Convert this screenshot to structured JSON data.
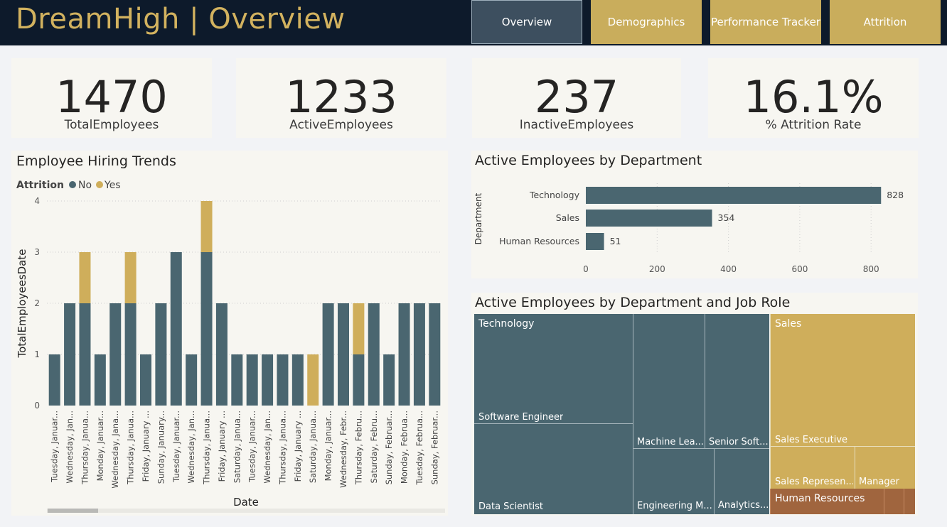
{
  "header": {
    "title": "DreamHigh | Overview"
  },
  "nav": [
    {
      "label": "Overview",
      "active": true
    },
    {
      "label": "Demographics",
      "active": false
    },
    {
      "label": "Performance Tracker",
      "active": false
    },
    {
      "label": "Attrition",
      "active": false
    }
  ],
  "kpis": [
    {
      "value": "1470",
      "label": "TotalEmployees"
    },
    {
      "value": "1233",
      "label": "ActiveEmployees"
    },
    {
      "value": "237",
      "label": "InactiveEmployees"
    },
    {
      "value": "16.1%",
      "label": "% Attrition Rate"
    }
  ],
  "colors": {
    "no": "#4a6670",
    "yes": "#cfae5b",
    "hr": "#a0653e",
    "bg": "#f7f6f1"
  },
  "chart_data": [
    {
      "type": "bar",
      "stacked": true,
      "title": "Employee Hiring Trends",
      "legend_title": "Attrition",
      "xlabel": "Date",
      "ylabel": "TotalEmployeesDate",
      "ylim": [
        0,
        4
      ],
      "yticks": [
        0,
        1,
        2,
        3,
        4
      ],
      "categories": [
        "Tuesday, Januar...",
        "Wednesday, Jan...",
        "Thursday, Janua...",
        "Monday, Januar...",
        "Wednesday, Jana...",
        "Thursday, Janua...",
        "Friday, January ...",
        "Sunday, January...",
        "Tuesday, Januar...",
        "Wednesday, Jan...",
        "Thursday, Janua...",
        "Friday, January ...",
        "Saturday, Janua...",
        "Tuesday, Januar...",
        "Wednesday, Jan...",
        "Thursday, Janua...",
        "Friday, January ...",
        "Saturday, Janua...",
        "Monday, Januar...",
        "Wednesday, Febr...",
        "Thursday, Febru...",
        "Saturday, Febru...",
        "Sunday, Februar...",
        "Monday, Februa...",
        "Tuesday, Februa...",
        "Sunday, Februar..."
      ],
      "series": [
        {
          "name": "No",
          "values": [
            1,
            2,
            2,
            1,
            2,
            2,
            1,
            2,
            3,
            1,
            3,
            2,
            1,
            1,
            1,
            1,
            1,
            0,
            2,
            2,
            1,
            2,
            1,
            2,
            2,
            2
          ]
        },
        {
          "name": "Yes",
          "values": [
            0,
            0,
            1,
            0,
            0,
            1,
            0,
            0,
            0,
            0,
            1,
            0,
            0,
            0,
            0,
            0,
            0,
            1,
            0,
            0,
            1,
            0,
            0,
            0,
            0,
            0
          ]
        }
      ],
      "legend_placement": "top-left",
      "grid": true
    },
    {
      "type": "bar",
      "orientation": "horizontal",
      "title": "Active Employees by Department",
      "ylabel": "Department",
      "xlabel": "",
      "categories": [
        "Technology",
        "Sales",
        "Human Resources"
      ],
      "values": [
        828,
        354,
        51
      ],
      "xlim": [
        0,
        900
      ],
      "xticks": [
        0,
        200,
        400,
        600,
        800
      ],
      "grid": true
    },
    {
      "type": "treemap",
      "title": "Active Employees by Department and Job Role",
      "groups": [
        {
          "name": "Technology",
          "color": "#4a6670",
          "roles": [
            "Software Engineer",
            "Data Scientist",
            "Machine Lea...",
            "Senior Soft...",
            "Engineering M...",
            "Analytics..."
          ]
        },
        {
          "name": "Sales",
          "color": "#cfae5b",
          "roles": [
            "Sales Executive",
            "Sales Represen...",
            "Manager"
          ]
        },
        {
          "name": "Human Resources",
          "color": "#a0653e",
          "roles": []
        }
      ]
    }
  ]
}
